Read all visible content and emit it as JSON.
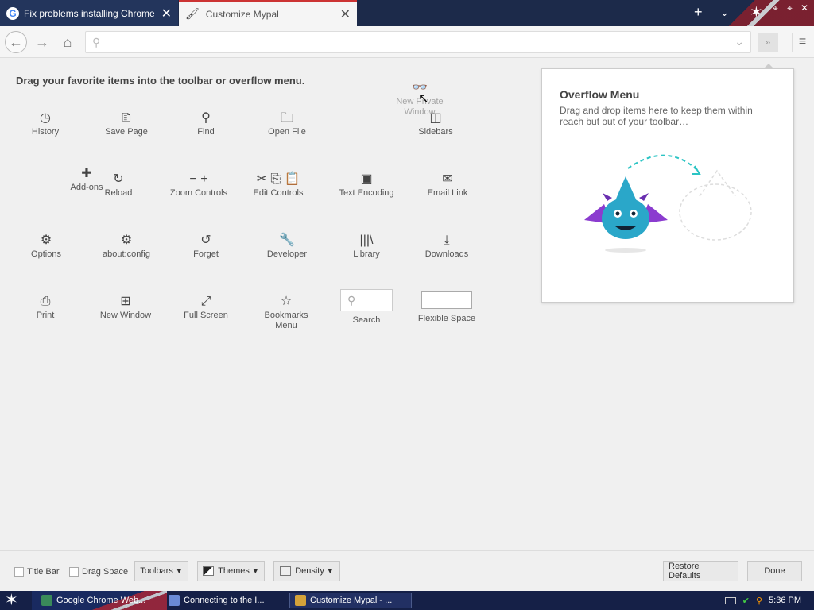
{
  "tabs": [
    {
      "label": "Fix problems installing Chrome - Go",
      "icon": "google-icon",
      "active": false
    },
    {
      "label": "Customize Mypal",
      "icon": "brush-icon",
      "active": true
    }
  ],
  "navbar": {
    "url_value": "",
    "overflow_glyph": "»"
  },
  "heading": "Drag your favorite items into the toolbar or overflow menu.",
  "dragging": {
    "line1": "New Private",
    "line2": "Window"
  },
  "palette": {
    "history": "History",
    "save_page": "Save Page",
    "find": "Find",
    "open_file": "Open File",
    "sidebars": "Sidebars",
    "addons": "Add-ons",
    "reload": "Reload",
    "zoom": "Zoom Controls",
    "edit": "Edit Controls",
    "encoding": "Text Encoding",
    "email": "Email Link",
    "options": "Options",
    "aboutconfig": "about:config",
    "forget": "Forget",
    "developer": "Developer",
    "library": "Library",
    "downloads": "Downloads",
    "print": "Print",
    "new_window": "New Window",
    "full_screen": "Full Screen",
    "bookmarks_menu": "Bookmarks Menu",
    "search": "Search",
    "flexible_space": "Flexible Space"
  },
  "overflow": {
    "title": "Overflow Menu",
    "description": "Drag and drop items here to keep them within reach but out of your toolbar…"
  },
  "custbar": {
    "title_bar": "Title Bar",
    "drag_space": "Drag Space",
    "toolbars": "Toolbars",
    "themes": "Themes",
    "density": "Density",
    "restore": "Restore Defaults",
    "done": "Done"
  },
  "taskbar": {
    "tasks": [
      "Google Chrome Web...",
      "Connecting to the I...",
      "Customize Mypal - ..."
    ],
    "clock": "5:36 PM"
  },
  "colors": {
    "accent": "#c33",
    "tab_dark": "#1c2a4a",
    "taskbar": "#152047",
    "dragon": "#2aa7c9"
  }
}
